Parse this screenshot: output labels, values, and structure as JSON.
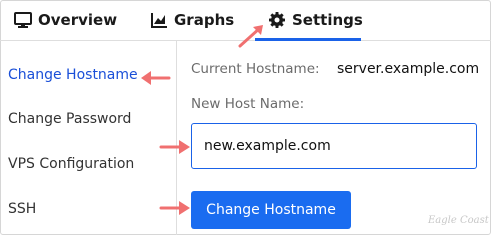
{
  "tabs": [
    {
      "label": "Overview",
      "icon": "monitor-icon"
    },
    {
      "label": "Graphs",
      "icon": "chart-icon"
    },
    {
      "label": "Settings",
      "icon": "gear-icon",
      "active": true
    }
  ],
  "sidebar": {
    "items": [
      {
        "label": "Change Hostname",
        "active": true
      },
      {
        "label": "Change Password"
      },
      {
        "label": "VPS Configuration"
      },
      {
        "label": "SSH"
      }
    ]
  },
  "form": {
    "current_label": "Current Hostname:",
    "current_value": "server.example.com",
    "new_label": "New Host Name:",
    "new_value": "new.example.com",
    "submit_label": "Change Hostname"
  },
  "watermark": "Eagle Coast",
  "colors": {
    "accent": "#1a6cf0",
    "active_link": "#1a4fd8",
    "annotation_arrow": "#f07070"
  }
}
